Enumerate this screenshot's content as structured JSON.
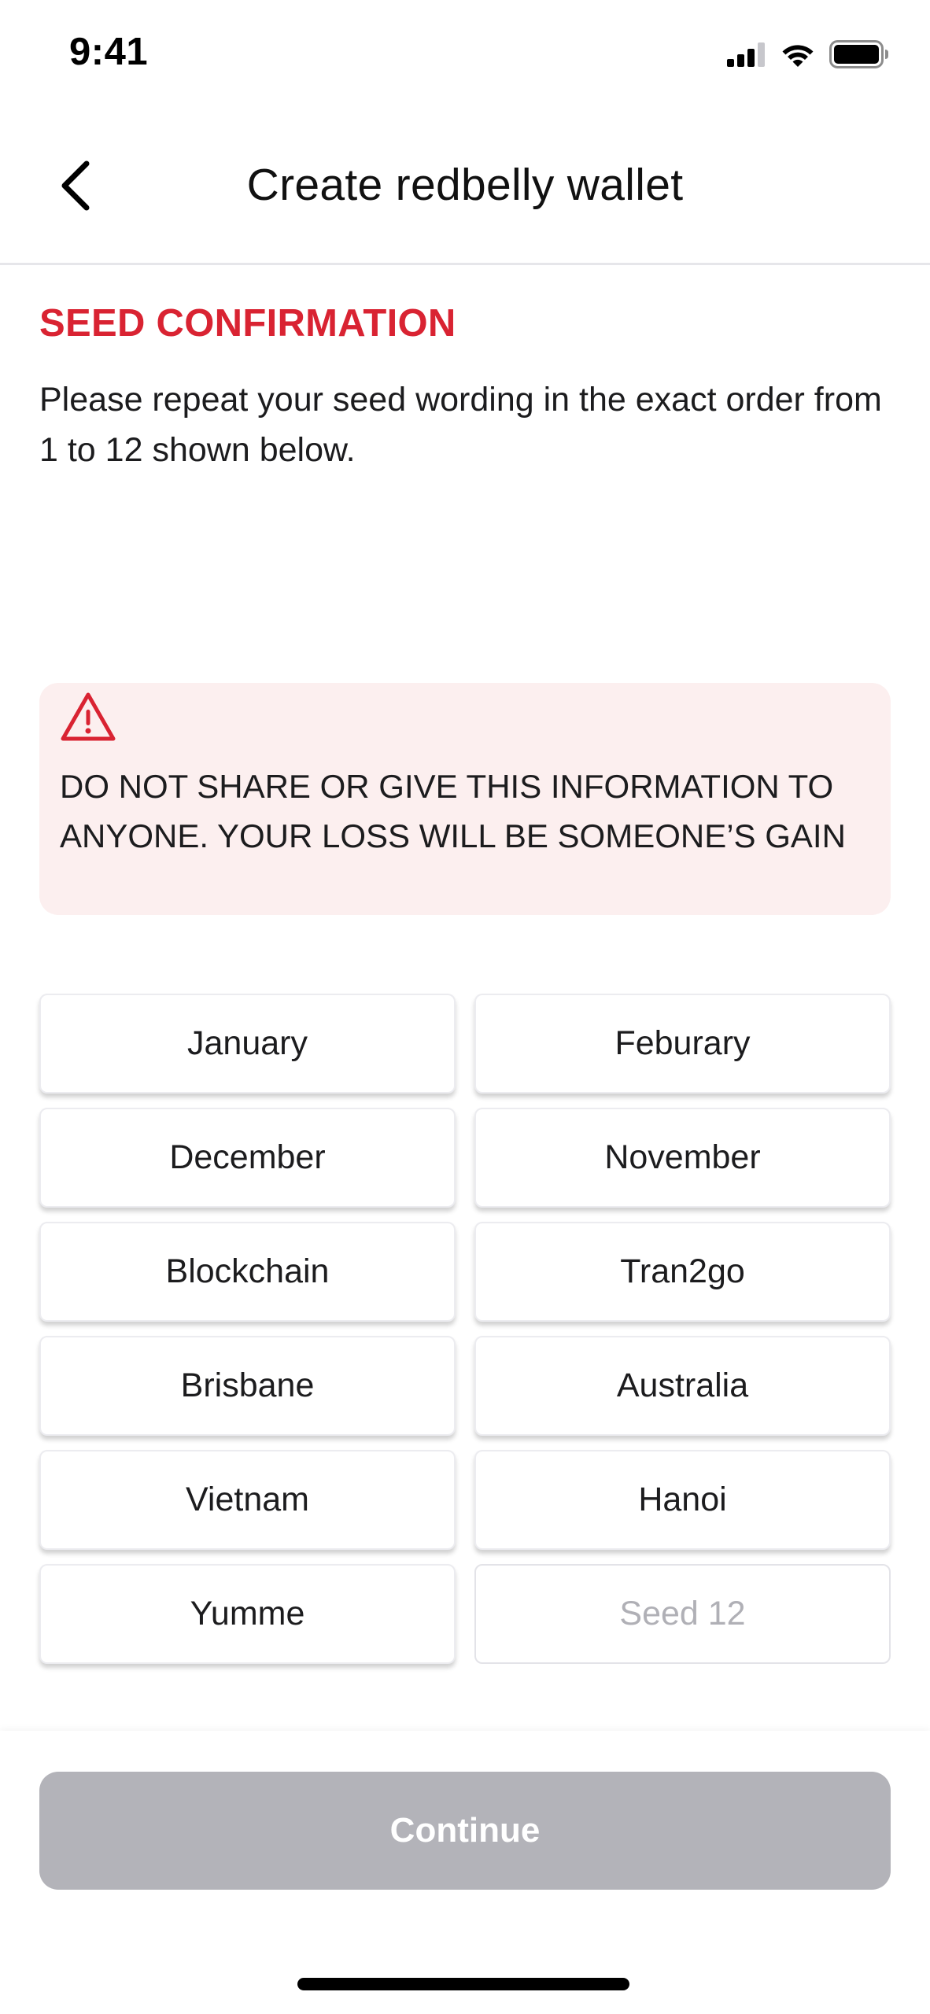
{
  "status_bar": {
    "time": "9:41",
    "icons": [
      "cellular-signal-icon",
      "wifi-icon",
      "battery-icon"
    ]
  },
  "nav": {
    "back_icon": "chevron-left-icon",
    "title": "Create redbelly wallet"
  },
  "content": {
    "heading": "SEED CONFIRMATION",
    "instruction": "Please repeat your seed wording in the exact order from 1 to 12 shown below."
  },
  "warning": {
    "icon": "warning-triangle-icon",
    "text": "DO NOT SHARE OR GIVE THIS INFORMATION TO ANYONE.  YOUR LOSS WILL BE SOMEONE’S GAIN"
  },
  "seeds": [
    {
      "label": "January"
    },
    {
      "label": "Feburary"
    },
    {
      "label": "December"
    },
    {
      "label": "November"
    },
    {
      "label": "Blockchain"
    },
    {
      "label": "Tran2go"
    },
    {
      "label": "Brisbane"
    },
    {
      "label": "Australia"
    },
    {
      "label": "Vietnam"
    },
    {
      "label": "Hanoi"
    },
    {
      "label": "Yumme"
    },
    {
      "label": "Seed 12"
    }
  ],
  "footer": {
    "continue_label": "Continue"
  },
  "colors": {
    "accent_red": "#d92332",
    "warning_bg": "#fcefef",
    "button_disabled": "#b3b3b9",
    "placeholder_text": "#b0b0b6"
  }
}
